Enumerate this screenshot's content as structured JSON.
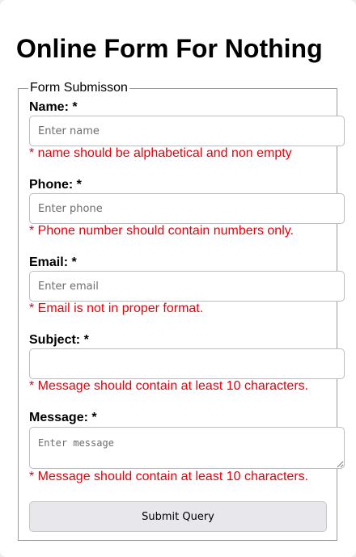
{
  "page": {
    "title": "Online Form For Nothing"
  },
  "form": {
    "legend": "Form Submisson",
    "fields": [
      {
        "label": "Name: *",
        "placeholder": "Enter name",
        "value": "",
        "error": "* name should be alphabetical and non empty"
      },
      {
        "label": "Phone: *",
        "placeholder": "Enter phone",
        "value": "",
        "error": "* Phone number should contain numbers only."
      },
      {
        "label": "Email: *",
        "placeholder": "Enter email",
        "value": "",
        "error": "* Email is not in proper format."
      },
      {
        "label": "Subject: *",
        "placeholder": "",
        "value": "",
        "error": "* Message should contain at least 10 characters."
      },
      {
        "label": "Message: *",
        "placeholder": "Enter message",
        "value": "",
        "error": "* Message should contain at least 10 characters."
      }
    ],
    "submit_label": "Submit Query"
  },
  "colors": {
    "error": "#e8000b",
    "button_bg": "#e8e8ec"
  }
}
